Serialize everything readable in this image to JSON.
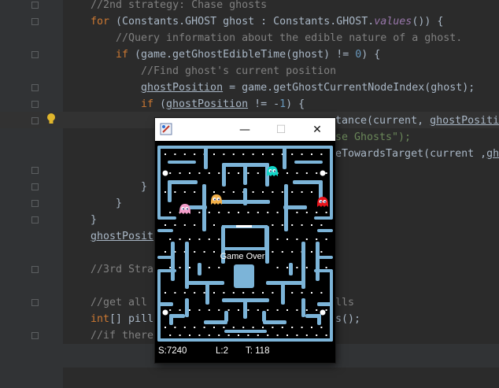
{
  "editor": {
    "lines": [
      {
        "id": "l1",
        "segments": [
          {
            "t": "//2nd strategy: Chase ghosts",
            "c": "cm"
          }
        ]
      },
      {
        "id": "l2",
        "segments": [
          {
            "t": "for",
            "c": "kw"
          },
          {
            "t": " (Constants.GHOST ghost : Constants.GHOST.",
            "c": ""
          },
          {
            "t": "values",
            "c": "fld"
          },
          {
            "t": "()) {",
            "c": ""
          }
        ]
      },
      {
        "id": "l3",
        "segments": [
          {
            "t": "//Query information about the edible nature of a ghost.",
            "c": "cm"
          }
        ]
      },
      {
        "id": "l4",
        "segments": [
          {
            "t": "if",
            "c": "kw"
          },
          {
            "t": " (game.getGhostEdibleTime(ghost) != ",
            "c": ""
          },
          {
            "t": "0",
            "c": "num"
          },
          {
            "t": ") {",
            "c": ""
          }
        ]
      },
      {
        "id": "l5",
        "segments": [
          {
            "t": "//Find ghost's current position",
            "c": "cm"
          }
        ]
      },
      {
        "id": "l6",
        "segments": [
          {
            "t": "ghostPosition",
            "c": "var"
          },
          {
            "t": " = game.getGhostCurrentNodeIndex(ghost);",
            "c": ""
          }
        ]
      },
      {
        "id": "l7",
        "segments": [
          {
            "t": "if",
            "c": "kw"
          },
          {
            "t": " (",
            "c": ""
          },
          {
            "t": "ghostPosition",
            "c": "var"
          },
          {
            "t": " != -",
            "c": ""
          },
          {
            "t": "1",
            "c": "num"
          },
          {
            "t": ") {",
            "c": ""
          }
        ]
      },
      {
        "id": "l8",
        "segments": [
          {
            "t": "tance(current, ",
            "c": ""
          },
          {
            "t": "ghostPositi",
            "c": "var"
          }
        ]
      },
      {
        "id": "l9",
        "segments": [
          {
            "t": "se Ghosts\");",
            "c": "str"
          }
        ]
      },
      {
        "id": "l10",
        "segments": [
          {
            "t": "eTowardsTarget(current ,",
            "c": ""
          },
          {
            "t": "gh",
            "c": "var"
          }
        ]
      },
      {
        "id": "l11",
        "segments": [
          {
            "t": "}",
            "c": ""
          }
        ]
      },
      {
        "id": "l12",
        "segments": [
          {
            "t": "}",
            "c": ""
          }
        ]
      },
      {
        "id": "l13",
        "segments": [
          {
            "t": "}",
            "c": ""
          }
        ]
      },
      {
        "id": "l14",
        "segments": [
          {
            "t": "ghostPosit",
            "c": "var"
          }
        ]
      },
      {
        "id": "l15",
        "segments": [
          {
            "t": "//3rd Stra",
            "c": "cm"
          }
        ]
      },
      {
        "id": "l16",
        "segments": [
          {
            "t": "//get all",
            "c": "cm"
          }
        ]
      },
      {
        "id": "l17",
        "segments": [
          {
            "t": "lls",
            "c": "cm"
          }
        ]
      },
      {
        "id": "l18",
        "segments": [
          {
            "t": "int",
            "c": "kw"
          },
          {
            "t": "[] pill",
            "c": ""
          }
        ]
      },
      {
        "id": "l19",
        "segments": [
          {
            "t": "s();",
            "c": ""
          }
        ]
      },
      {
        "id": "l20",
        "segments": [
          {
            "t": "//if there",
            "c": "cm"
          }
        ]
      }
    ]
  },
  "game_window": {
    "minimize_glyph": "—",
    "maximize_glyph": "☐",
    "close_glyph": "✕",
    "center_text": "Game Over",
    "status": {
      "score": "S:7240",
      "lives": "L:2",
      "time": "T: 118"
    }
  },
  "colors": {
    "wall": "#7cb4d8",
    "ghost_cyan": "#11d6c8",
    "ghost_red": "#e8141c",
    "ghost_pink": "#f29cc8",
    "ghost_orange": "#f2b04a",
    "pill": "#ffffff"
  }
}
